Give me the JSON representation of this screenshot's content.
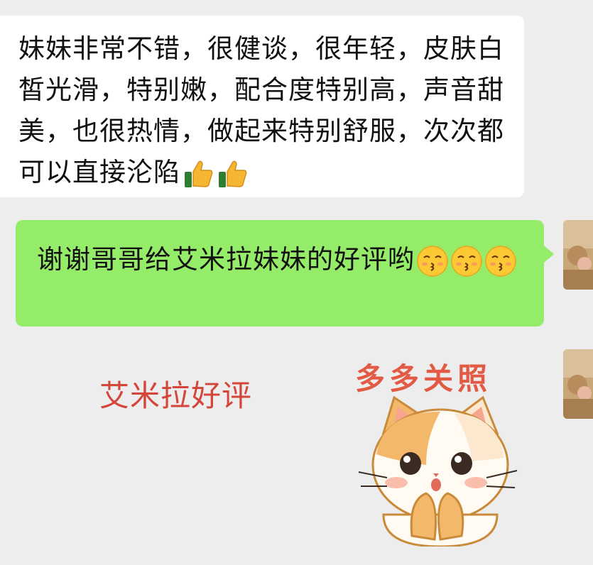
{
  "messages": {
    "incoming_text": "妹妹非常不错，很健谈，很年轻，皮肤白皙光滑，特别嫩，配合度特别高，声音甜美，也很热情，做起来特别舒服，次次都可以直接沦陷",
    "incoming_emoji": [
      "thumbs-up-icon",
      "thumbs-up-icon"
    ],
    "outgoing_text": "谢谢哥哥给艾米拉妹妹的好评哟",
    "outgoing_emoji": [
      "kissing-face-icon",
      "kissing-face-icon",
      "kissing-face-icon"
    ]
  },
  "sticker": {
    "caption": "艾米拉好评",
    "title": "多多关照",
    "icon": "cat-sticker-icon"
  },
  "colors": {
    "background": "#ededed",
    "incoming_bubble": "#ffffff",
    "outgoing_bubble": "#95ec69",
    "caption": "#d4453a",
    "sticker_title": "#e25a44"
  }
}
